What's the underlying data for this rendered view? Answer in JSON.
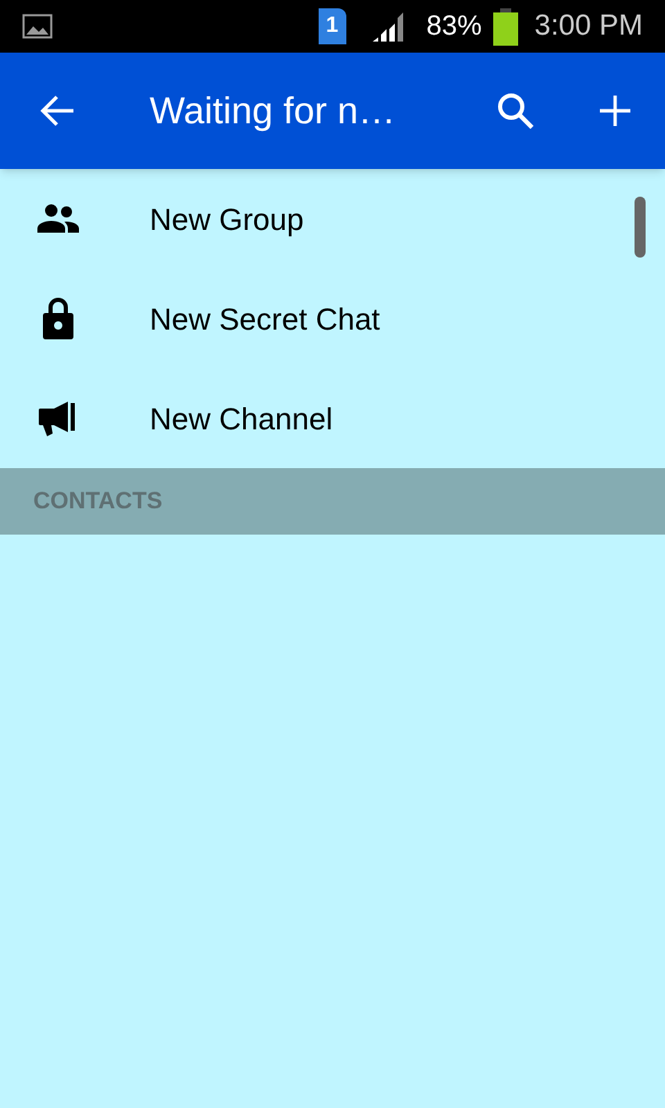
{
  "status_bar": {
    "sim_slot": "1",
    "battery": "83%",
    "time": "3:00 PM"
  },
  "toolbar": {
    "title": "Waiting for n…"
  },
  "menu_items": [
    {
      "kind": "group",
      "label": "New Group"
    },
    {
      "kind": "lock",
      "label": "New Secret Chat"
    },
    {
      "kind": "channel",
      "label": "New Channel"
    }
  ],
  "section_header": "CONTACTS"
}
